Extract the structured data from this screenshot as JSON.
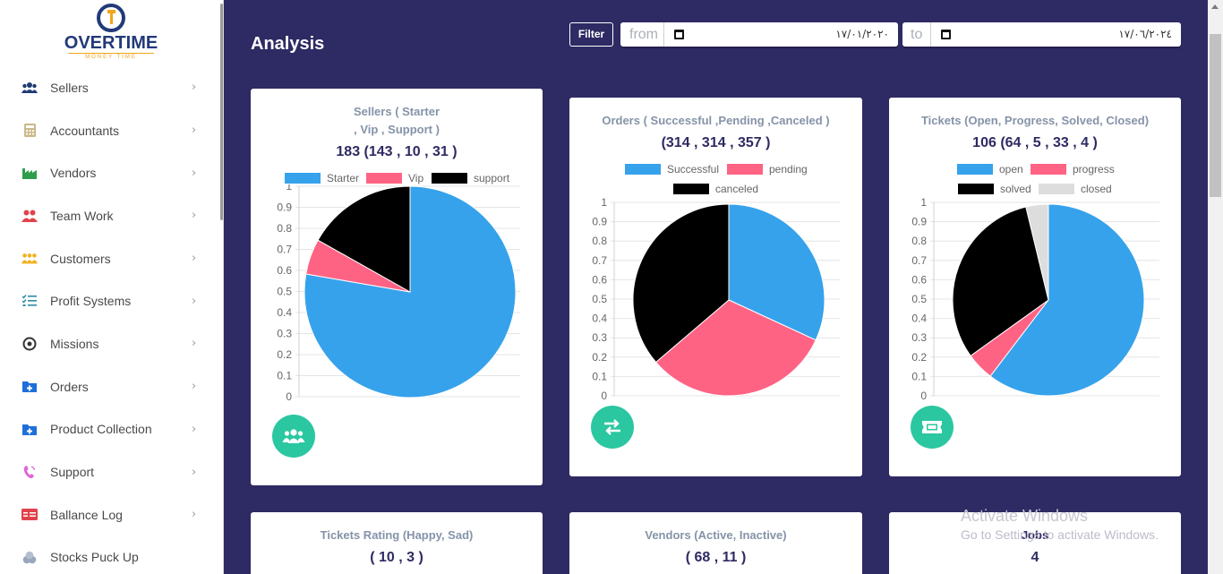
{
  "brand": {
    "name": "OVERTIME",
    "tagline": "MONEY TIME"
  },
  "sidebar": {
    "items": [
      {
        "label": "Sellers",
        "icon": "users-icon"
      },
      {
        "label": "Accountants",
        "icon": "calculator-icon"
      },
      {
        "label": "Vendors",
        "icon": "factory-icon"
      },
      {
        "label": "Team Work",
        "icon": "team-icon"
      },
      {
        "label": "Customers",
        "icon": "customers-icon"
      },
      {
        "label": "Profit Systems",
        "icon": "list-check-icon"
      },
      {
        "label": "Missions",
        "icon": "target-icon"
      },
      {
        "label": "Orders",
        "icon": "folder-plus-icon"
      },
      {
        "label": "Product Collection",
        "icon": "folder-plus-icon"
      },
      {
        "label": "Support",
        "icon": "phone-icon"
      },
      {
        "label": "Ballance Log",
        "icon": "money-icon"
      },
      {
        "label": "Stocks Puck Up",
        "icon": "coins-icon"
      }
    ]
  },
  "header": {
    "title": "Analysis",
    "filter_label": "Filter",
    "from_label": "from",
    "from_value": "١٧/٠١/٢٠٢٠",
    "to_label": "to",
    "to_value": "١٧/٠٦/٢٠٢٤"
  },
  "cards": {
    "sellers": {
      "title_line1": "Sellers ( Starter",
      "title_line2": ", Vip , Support )",
      "value": "183 (143 , 10 , 31 )"
    },
    "orders": {
      "title": "Orders ( Successful ,Pending ,Canceled )",
      "value": "(314 , 314 , 357 )"
    },
    "tickets": {
      "title": "Tickets (Open, Progress, Solved, Closed)",
      "value": "106 (64 , 5 , 33 , 4 )"
    },
    "rating": {
      "title": "Tickets Rating (Happy, Sad)",
      "value": "( 10 , 3 )"
    },
    "vendors": {
      "title": "Vendors (Active, Inactive)",
      "value": "( 68 , 11 )"
    },
    "jobs": {
      "title": "Jobs",
      "value": "4"
    }
  },
  "watermark": {
    "line1": "Activate Windows",
    "line2": "Go to Settings to activate Windows."
  },
  "colors": {
    "blue": "#36a2eb",
    "pink": "#ff6384",
    "black": "#000000",
    "grey": "#dddddd",
    "teal": "#2bc7a0",
    "navy": "#2e2a63"
  },
  "chart_data": [
    {
      "type": "pie",
      "labels": [
        "Starter",
        "Vip",
        "support"
      ],
      "values": [
        143,
        10,
        31
      ],
      "colors": [
        "#36a2eb",
        "#ff6384",
        "#000000"
      ],
      "ylim": [
        0,
        1
      ],
      "yticks": [
        "1",
        "0.9",
        "0.8",
        "0.7",
        "0.6",
        "0.5",
        "0.4",
        "0.3",
        "0.2",
        "0.1",
        "0"
      ]
    },
    {
      "type": "pie",
      "labels": [
        "Successful",
        "pending",
        "canceled"
      ],
      "values": [
        314,
        314,
        357
      ],
      "colors": [
        "#36a2eb",
        "#ff6384",
        "#000000"
      ],
      "ylim": [
        0,
        1
      ],
      "yticks": [
        "1",
        "0.9",
        "0.8",
        "0.7",
        "0.6",
        "0.5",
        "0.4",
        "0.3",
        "0.2",
        "0.1",
        "0"
      ]
    },
    {
      "type": "pie",
      "labels": [
        "open",
        "progress",
        "solved",
        "closed"
      ],
      "values": [
        64,
        5,
        33,
        4
      ],
      "colors": [
        "#36a2eb",
        "#ff6384",
        "#000000",
        "#dddddd"
      ],
      "ylim": [
        0,
        1
      ],
      "yticks": [
        "1",
        "0.9",
        "0.8",
        "0.7",
        "0.6",
        "0.5",
        "0.4",
        "0.3",
        "0.2",
        "0.1",
        "0"
      ]
    }
  ]
}
